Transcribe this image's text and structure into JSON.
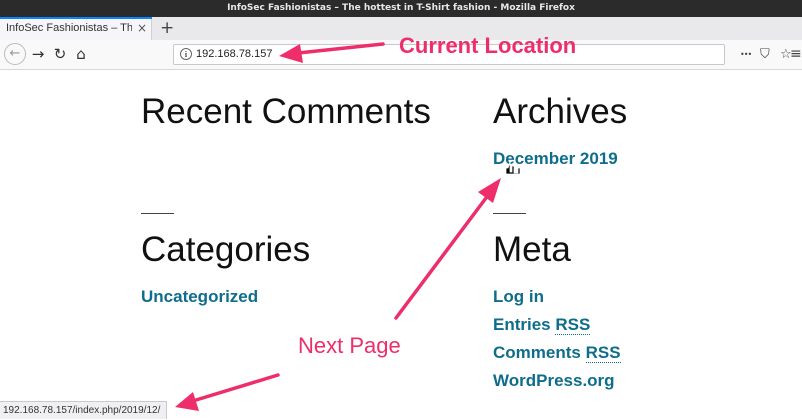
{
  "window": {
    "title": "InfoSec Fashionistas – The hottest in T-Shirt fashion - Mozilla Firefox"
  },
  "tabs": [
    {
      "title": "InfoSec Fashionistas – The h",
      "close": "×"
    }
  ],
  "tabstrip": {
    "new_tab": "+"
  },
  "navbar": {
    "back": "←",
    "forward": "→",
    "reload": "↻",
    "home": "⌂"
  },
  "urlbar": {
    "info": "i",
    "url": "192.168.78.157"
  },
  "toolbar": {
    "overflow": "•••",
    "pocket": "⛉",
    "bookmark": "☆",
    "menu": "≡"
  },
  "widgets": {
    "recent_comments": {
      "title": "Recent Comments"
    },
    "archives": {
      "title": "Archives",
      "items": [
        "December 2019"
      ]
    },
    "categories": {
      "title": "Categories",
      "items": [
        "Uncategorized"
      ]
    },
    "meta": {
      "title": "Meta",
      "log_in": "Log in",
      "entries": "Entries ",
      "comments": "Comments ",
      "rss": "RSS",
      "wordpress": "WordPress.org"
    }
  },
  "annotations": {
    "current_location": "Current Location",
    "next_page": "Next Page",
    "color": "#ee2e6b"
  },
  "statusbar": {
    "url": "192.168.78.157/index.php/2019/12/"
  }
}
